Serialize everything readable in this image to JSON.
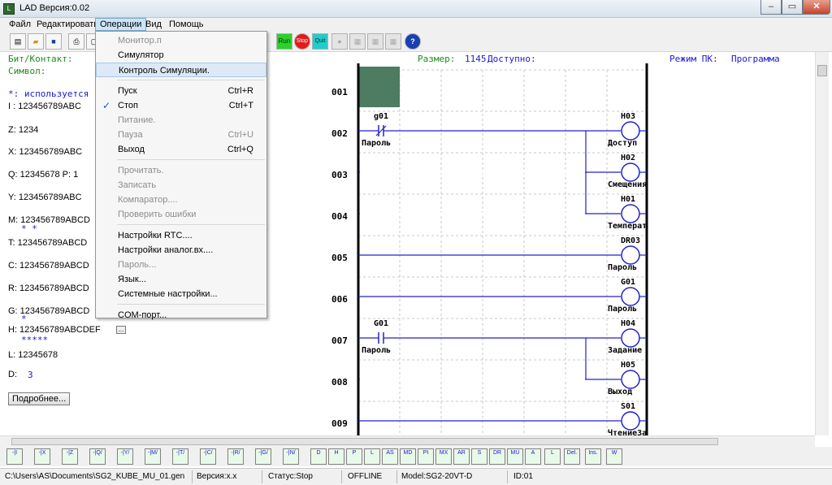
{
  "window": {
    "title": "LAD Версия:0.02"
  },
  "menu": [
    "Файл",
    "Редактировать",
    "Операции",
    "Вид",
    "Помощь"
  ],
  "toolbar": {
    "buttons": [
      "new-file",
      "open-file",
      "save",
      "print",
      "sep",
      "monitor",
      "sim",
      "simstop",
      "stop",
      "quit",
      "dis1",
      "dis2",
      "dis3",
      "dis4",
      "help"
    ],
    "run_label": "Run",
    "stop_label": "Stop",
    "quit_label": "Quit"
  },
  "left": {
    "bit_contact": "Бит/Контакт:",
    "symbol": "Символ:",
    "used_note": "*: используется в пр",
    "rows": [
      "I : 123456789ABC",
      "Z: 1234",
      "X: 123456789ABC",
      "Q: 12345678   P: 1",
      "Y: 123456789ABC",
      "M: 123456789ABCD",
      "T: 123456789ABCD",
      "C: 123456789ABCD",
      "R: 123456789ABCD",
      "G: 123456789ABCD",
      "H: 123456789ABCDEF",
      "L: 12345678"
    ],
    "m_marks": "*                *",
    "g_marks": "*",
    "h_marks": "*****",
    "d_label": "D:",
    "d_value": "3",
    "more_btn": "Подробнее..."
  },
  "operations_menu": {
    "items": [
      {
        "label": "Монитор.п",
        "shortcut": "",
        "disabled": true
      },
      {
        "label": "Симулятор",
        "shortcut": "",
        "disabled": false
      },
      {
        "label": "Контроль Симуляции.",
        "shortcut": "",
        "disabled": false,
        "highlight": true
      },
      {
        "sep": true
      },
      {
        "label": "Пуск",
        "shortcut": "Ctrl+R",
        "disabled": false
      },
      {
        "label": "Стоп",
        "shortcut": "Ctrl+T",
        "disabled": false,
        "checked": true
      },
      {
        "label": "Питание.",
        "shortcut": "",
        "disabled": true
      },
      {
        "label": "Пауза",
        "shortcut": "Ctrl+U",
        "disabled": true
      },
      {
        "label": "Выход",
        "shortcut": "Ctrl+Q",
        "disabled": false
      },
      {
        "sep": true
      },
      {
        "label": "Прочитать.",
        "shortcut": "",
        "disabled": true
      },
      {
        "label": "Записать",
        "shortcut": "",
        "disabled": true
      },
      {
        "label": "Компаратор....",
        "shortcut": "",
        "disabled": true
      },
      {
        "label": "Проверить ошибки",
        "shortcut": "",
        "disabled": true
      },
      {
        "sep": true
      },
      {
        "label": "Настройки RTC....",
        "shortcut": "",
        "disabled": false
      },
      {
        "label": "Настройки аналог.вх....",
        "shortcut": "",
        "disabled": false
      },
      {
        "label": "Пароль...",
        "shortcut": "",
        "disabled": true
      },
      {
        "label": "Язык...",
        "shortcut": "",
        "disabled": false
      },
      {
        "label": "Системные настройки...",
        "shortcut": "",
        "disabled": false
      },
      {
        "sep": true
      },
      {
        "label": "COM-порт...",
        "shortcut": "",
        "disabled": false
      }
    ]
  },
  "ladder": {
    "size_label": "Размер:",
    "size_value": "1145",
    "avail_label": "Доступно:",
    "mode_label": "Режим ПК:",
    "mode_value": "Программа",
    "row_numbers": [
      "001",
      "002",
      "003",
      "004",
      "005",
      "006",
      "007",
      "008",
      "009"
    ],
    "contacts": [
      {
        "row": 2,
        "name": "g01",
        "label": "Пароль",
        "type": "nc"
      },
      {
        "row": 7,
        "name": "G01",
        "label": "Пароль",
        "type": "no"
      }
    ],
    "coils": [
      {
        "row": 2,
        "name": "H03",
        "label": "Доступ"
      },
      {
        "row": 3,
        "name": "H02",
        "label": "Смещения"
      },
      {
        "row": 4,
        "name": "H01",
        "label": "Температ"
      },
      {
        "row": 5,
        "name": "DR03",
        "label": "Пароль"
      },
      {
        "row": 6,
        "name": "G01",
        "label": "Пароль"
      },
      {
        "row": 7,
        "name": "H04",
        "label": "Задание"
      },
      {
        "row": 8,
        "name": "H05",
        "label": "Выход"
      },
      {
        "row": 9,
        "name": "S01",
        "label": "ЧтениеЗа"
      }
    ],
    "colors": {
      "rung": "#2222cc",
      "cell": "#4d7c63",
      "grid": "#c9c9c9",
      "text": "#000000"
    }
  },
  "bottombar": {
    "buttons": [
      "-|I",
      "-|X",
      "-|Z",
      "-|Q/",
      "-|Y/",
      "-|M/",
      "-|T/",
      "-|C/",
      "-|R/",
      "-|G/",
      "-|N/",
      "D",
      "H",
      "P",
      "L",
      "AS",
      "MD",
      "PI",
      "MX",
      "AR",
      "S",
      "DR",
      "MU",
      "A",
      "L",
      "Del.",
      "Ins.",
      "W"
    ]
  },
  "status": {
    "path": "C:\\Users\\AS\\Documents\\SG2_KUBE_MU_01.gen",
    "version": "Версия:x.x",
    "state": "Статус:Stop",
    "online": "OFFLINE",
    "model": "Model:SG2-20VT-D",
    "id": "ID:01"
  }
}
